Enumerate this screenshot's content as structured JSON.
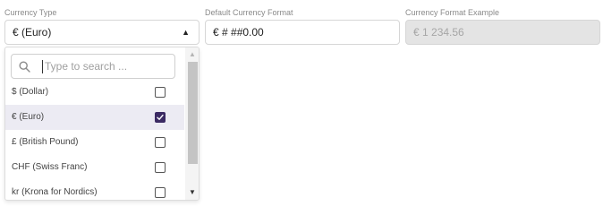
{
  "labels": {
    "currency_type": "Currency Type",
    "default_format": "Default Currency Format",
    "format_example": "Currency Format Example"
  },
  "currency_select": {
    "value": "€ (Euro)",
    "expanded": true
  },
  "format_input": {
    "value": "€ # ##0.00"
  },
  "example_input": {
    "value": "€ 1 234.56",
    "disabled": true
  },
  "dropdown": {
    "search_placeholder": "Type to search ...",
    "options": [
      {
        "label": "$ (Dollar)",
        "checked": false
      },
      {
        "label": "€ (Euro)",
        "checked": true
      },
      {
        "label": "£ (British Pound)",
        "checked": false
      },
      {
        "label": "CHF (Swiss Franc)",
        "checked": false
      },
      {
        "label": "kr (Krona for Nordics)",
        "checked": false
      }
    ]
  },
  "colors": {
    "accent": "#3b2a63",
    "selected_row": "#ecebf3",
    "disabled_bg": "#e4e4e4"
  }
}
